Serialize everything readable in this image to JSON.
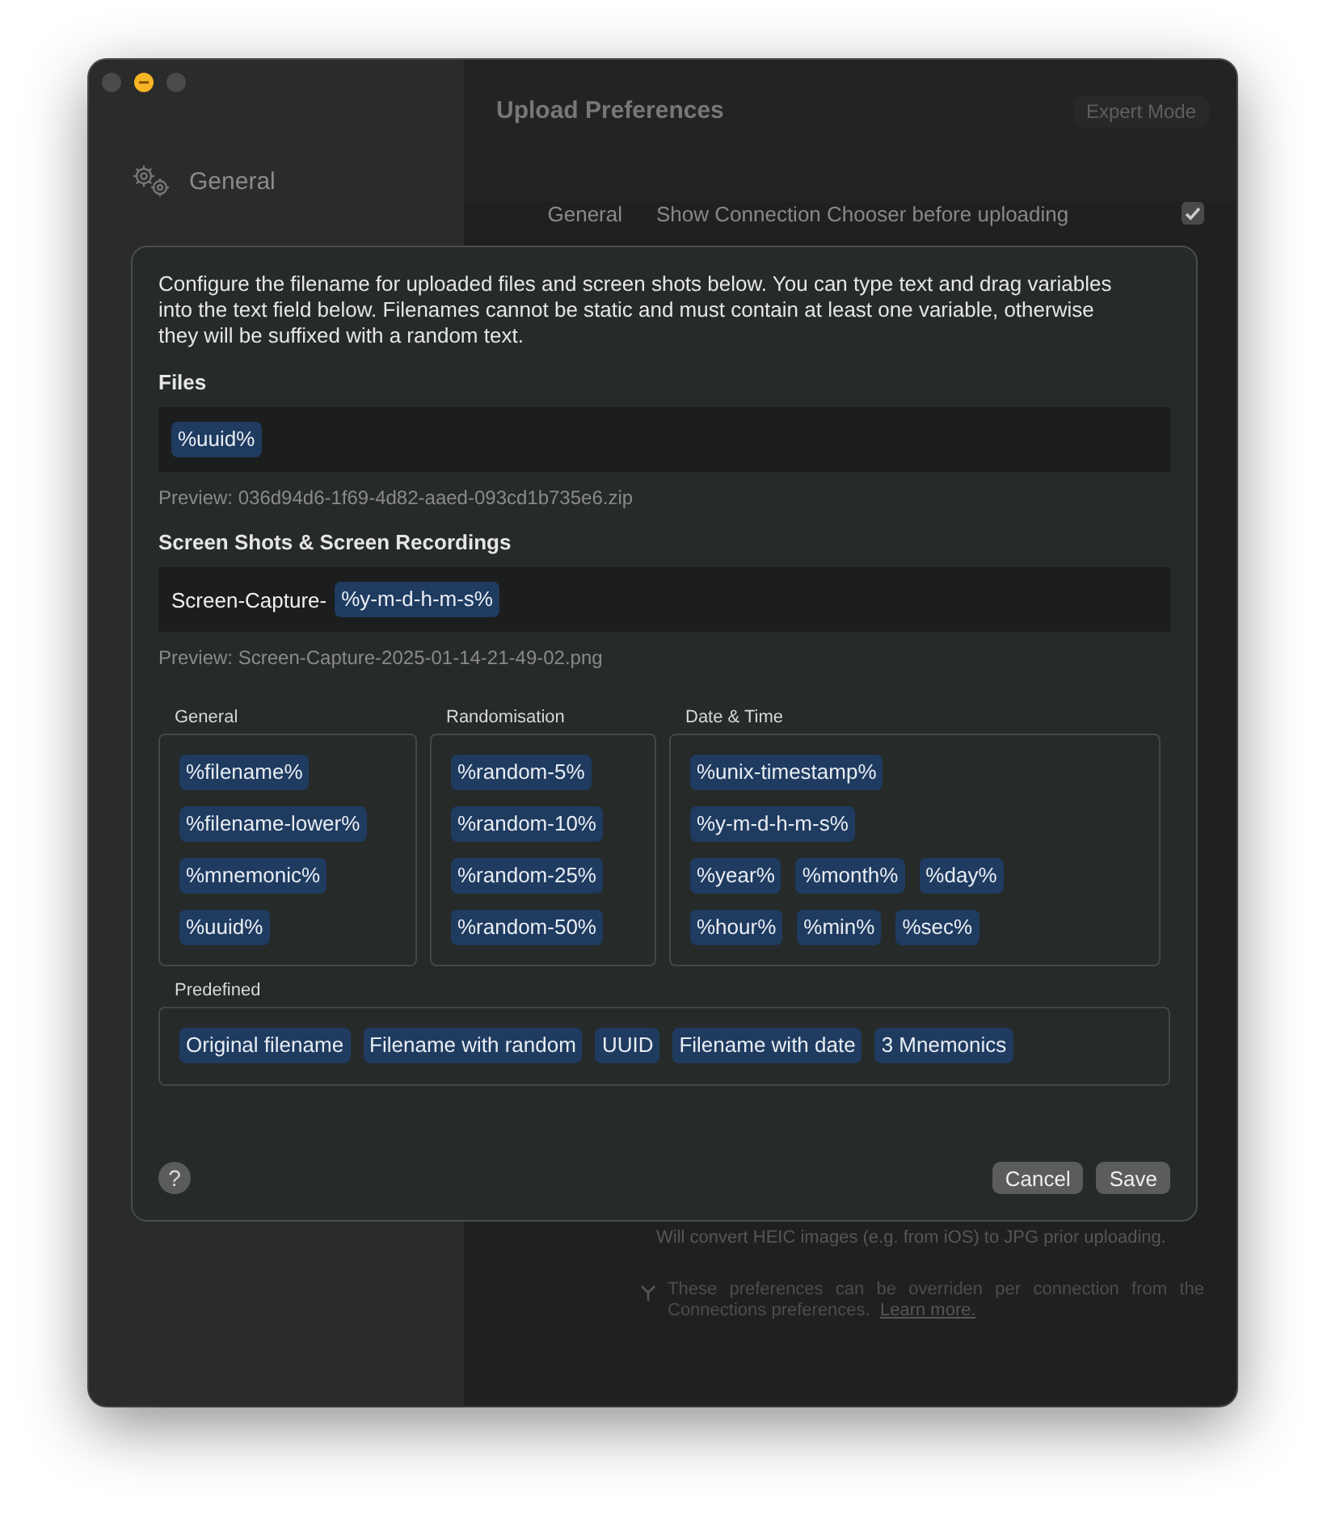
{
  "window": {
    "controls": [
      {
        "kind": "close",
        "hovered": false
      },
      {
        "kind": "minimize",
        "hovered": true
      },
      {
        "kind": "zoom",
        "hovered": false
      }
    ]
  },
  "sidebar": {
    "items": [
      {
        "label": "General",
        "selected": false
      }
    ]
  },
  "header": {
    "title": "Upload Preferences",
    "expert_mode_button": {
      "label": "Expert Mode",
      "disabled": true
    }
  },
  "settings": [
    {
      "section": "General",
      "label": "Show Connection Chooser before uploading",
      "checked": true
    }
  ],
  "heic_note": "Will convert HEIC images (e.g. from iOS) to JPG prior uploading.",
  "footnote": {
    "text": "These preferences can be overriden per connection from the Connections preferences.",
    "link": "Learn more."
  },
  "sheet": {
    "intro": "Configure the filename for uploaded files and screen shots below. You can type text and drag variables into the text field below. Filenames cannot be static and must contain at least one variable, otherwise they will be suffixed with a random text.",
    "fields": [
      {
        "heading": "Files",
        "parts": [
          {
            "kind": "token",
            "text": "%uuid%"
          }
        ],
        "preview": "Preview: 036d94d6-1f69-4d82-aaed-093cd1b735e6.zip"
      },
      {
        "heading": "Screen Shots & Screen Recordings",
        "parts": [
          {
            "kind": "text",
            "text": "Screen-Capture-"
          },
          {
            "kind": "token",
            "text": "%y-m-d-h-m-s%"
          }
        ],
        "preview": "Preview: Screen-Capture-2025-01-14-21-49-02.png"
      }
    ],
    "groups": [
      {
        "label": "General",
        "rows": [
          [
            "%filename%"
          ],
          [
            "%filename-lower%"
          ],
          [
            "%mnemonic%"
          ],
          [
            "%uuid%"
          ]
        ]
      },
      {
        "label": "Randomisation",
        "rows": [
          [
            "%random-5%"
          ],
          [
            "%random-10%"
          ],
          [
            "%random-25%"
          ],
          [
            "%random-50%"
          ]
        ]
      },
      {
        "label": "Date & Time",
        "rows": [
          [
            "%unix-timestamp%"
          ],
          [
            "%y-m-d-h-m-s%"
          ],
          [
            "%year%",
            "%month%",
            "%day%"
          ],
          [
            "%hour%",
            "%min%",
            "%sec%"
          ]
        ]
      }
    ],
    "predefined": {
      "label": "Predefined",
      "items": [
        "Original filename",
        "Filename with random",
        "UUID",
        "Filename with date",
        "3 Mnemonics"
      ]
    },
    "help": "?",
    "buttons": [
      "Cancel",
      "Save"
    ]
  }
}
